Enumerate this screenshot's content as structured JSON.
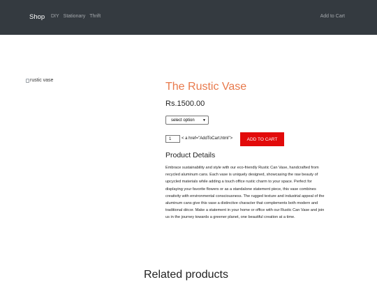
{
  "nav": {
    "brand": "Shop",
    "links": [
      "DIY",
      "Stationary",
      "Thrift"
    ],
    "right_link": "Add to Cart"
  },
  "product": {
    "image_alt": "rustic vase",
    "title": "The Rustic Vase",
    "price": "Rs.1500.00",
    "select": {
      "selected": "select option"
    },
    "quantity": "1",
    "raw_link_text": "< a href=\"AddToCart.html\">",
    "add_button": "ADD TO CART",
    "details_heading": "Product Details",
    "description": "Embrace sustainability and style with our eco-friendly Rustic Can Vase, handcrafted from recycled aluminum cans. Each vase is uniquely designed, showcasing the raw beauty of upcycled materials while adding a touch office rustic charm to your space. Perfect for displaying your favorite flowers or as a standalone statement piece, this vase combines creativity with environmental consciousness. The rugged texture and industrial appeal of the aluminum cans give this vase a distinctive character that complements both modern and traditional décor. Make a statement in your home or office with our Rustic Can Vase and join us in the journey towards a greener planet, one beautiful creation at a time."
  },
  "related": {
    "heading": "Related products"
  },
  "colors": {
    "nav_bg": "#343a40",
    "title": "#e8794b",
    "button": "#e20a0a"
  }
}
